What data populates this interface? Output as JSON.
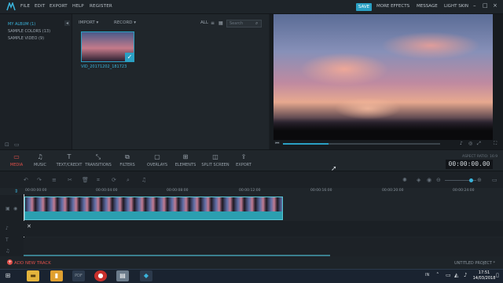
{
  "menu": {
    "file": "FILE",
    "edit": "EDIT",
    "export": "EXPORT",
    "help": "HELP",
    "register": "REGISTER"
  },
  "topright": {
    "save": "SAVE",
    "more_effects": "MORE EFFECTS",
    "message": "MESSAGE",
    "light_skin": "LIGHT SKIN"
  },
  "library": {
    "items": [
      "MY ALBUM (1)",
      "SAMPLE COLORS (13)",
      "SAMPLE VIDEO (9)"
    ]
  },
  "media": {
    "import": "IMPORT",
    "record": "RECORD",
    "filter": "ALL",
    "search_placeholder": "Search",
    "clip_name": "VID_20171202_181723"
  },
  "tools": [
    {
      "label": "MEDIA",
      "icon": "folder-icon"
    },
    {
      "label": "MUSIC",
      "icon": "music-icon"
    },
    {
      "label": "TEXT/CREDIT",
      "icon": "text-icon"
    },
    {
      "label": "TRANSITIONS",
      "icon": "transition-icon"
    },
    {
      "label": "FILTERS",
      "icon": "filter-icon"
    },
    {
      "label": "OVERLAYS",
      "icon": "overlay-icon"
    },
    {
      "label": "ELEMENTS",
      "icon": "elements-icon"
    },
    {
      "label": "SPLIT SCREEN",
      "icon": "split-icon"
    },
    {
      "label": "EXPORT",
      "icon": "export-icon"
    }
  ],
  "preview": {
    "aspect_ratio": "ASPECT RATIO: 16:9",
    "timecode": "00:00:00.00",
    "progress": 0.29
  },
  "timeline": {
    "ticks": [
      "00:00:00:00",
      "00:00:04:00",
      "00:00:08:00",
      "00:00:12:00",
      "00:00:16:00",
      "00:00:20:00",
      "00:00:24:00"
    ],
    "add_track": "ADD NEW TRACK",
    "project": "UNTITLED PROJECT *"
  },
  "taskbar": {
    "lang": "IN",
    "time": "17:51",
    "date": "14/03/2018"
  },
  "colors": {
    "accent": "#2aa0c4",
    "active_tool": "#e0504a",
    "clip": "#2b9fb0"
  }
}
